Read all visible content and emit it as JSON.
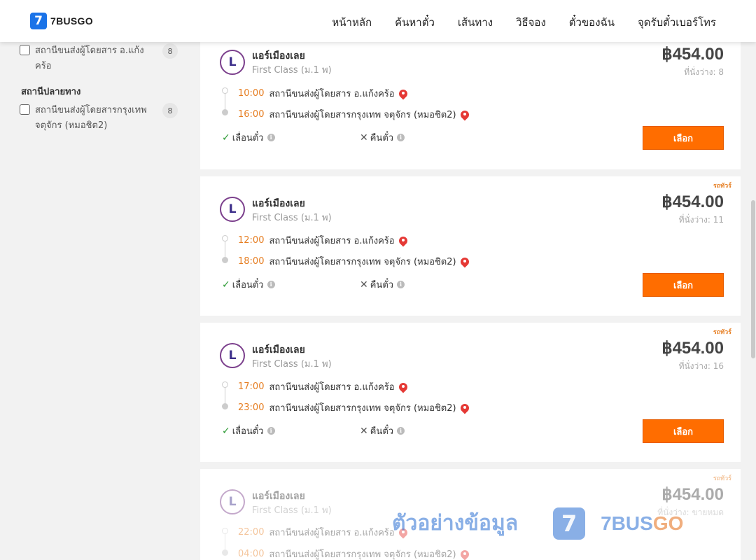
{
  "header": {
    "logo_digit": "7",
    "logo_text": "7BUSGO",
    "nav": [
      "หน้าหลัก",
      "ค้นหาตั๋ว",
      "เส้นทาง",
      "วิธีจอง",
      "ตั๋วของฉัน",
      "จุดรับตั๋วเบอร์โทร"
    ]
  },
  "sidebar": {
    "origin_item": {
      "label": "สถานีขนส่งผู้โดยสาร อ.แก้งคร้อ",
      "count": "8"
    },
    "destination_heading": "สถานีปลายทาง",
    "destination_item": {
      "label": "สถานีขนส่งผู้โดยสารกรุงเทพ จตุจักร (หมอชิต2)",
      "count": "8"
    }
  },
  "cards": [
    {
      "badge": "",
      "operator": "แอร์เมืองเลย",
      "bus_class": "First Class (ม.1 พ)",
      "price": "฿454.00",
      "seats": "ที่นั่งว่าง: 8",
      "depart_time": "10:00",
      "depart_station": "สถานีขนส่งผู้โดยสาร อ.แก้งคร้อ",
      "arrive_time": "16:00",
      "arrive_station": "สถานีขนส่งผู้โดยสารกรุงเทพ จตุจักร (หมอชิต2)",
      "reschedule": "เลื่อนตั๋ว",
      "refund": "คืนตั๋ว",
      "select": "เลือก"
    },
    {
      "badge": "รถทัวร์",
      "operator": "แอร์เมืองเลย",
      "bus_class": "First Class (ม.1 พ)",
      "price": "฿454.00",
      "seats": "ที่นั่งว่าง: 11",
      "depart_time": "12:00",
      "depart_station": "สถานีขนส่งผู้โดยสาร อ.แก้งคร้อ",
      "arrive_time": "18:00",
      "arrive_station": "สถานีขนส่งผู้โดยสารกรุงเทพ จตุจักร (หมอชิต2)",
      "reschedule": "เลื่อนตั๋ว",
      "refund": "คืนตั๋ว",
      "select": "เลือก"
    },
    {
      "badge": "รถทัวร์",
      "operator": "แอร์เมืองเลย",
      "bus_class": "First Class (ม.1 พ)",
      "price": "฿454.00",
      "seats": "ที่นั่งว่าง: 16",
      "depart_time": "17:00",
      "depart_station": "สถานีขนส่งผู้โดยสาร อ.แก้งคร้อ",
      "arrive_time": "23:00",
      "arrive_station": "สถานีขนส่งผู้โดยสารกรุงเทพ จตุจักร (หมอชิต2)",
      "reschedule": "เลื่อนตั๋ว",
      "refund": "คืนตั๋ว",
      "select": "เลือก"
    },
    {
      "badge": "รถทัวร์",
      "operator": "แอร์เมืองเลย",
      "bus_class": "First Class (ม.1 พ)",
      "price": "฿454.00",
      "seats": "ที่นั่งว่าง: ขายหมด",
      "depart_time": "22:00",
      "depart_station": "สถานีขนส่งผู้โดยสาร อ.แก้งคร้อ",
      "arrive_time": "04:00",
      "arrive_station": "สถานีขนส่งผู้โดยสารกรุงเทพ จตุจักร (หมอชิต2)"
    }
  ],
  "watermark": {
    "text": "ตัวอย่างข้อมูล",
    "logo_digit": "7",
    "brand_part1": "7BUS",
    "brand_part2": "GO"
  },
  "colors": {
    "accent": "#ff6d00",
    "time": "#e67e22",
    "pin": "#e53935",
    "check": "#2e9b36",
    "brand_blue": "#1a73e8"
  }
}
